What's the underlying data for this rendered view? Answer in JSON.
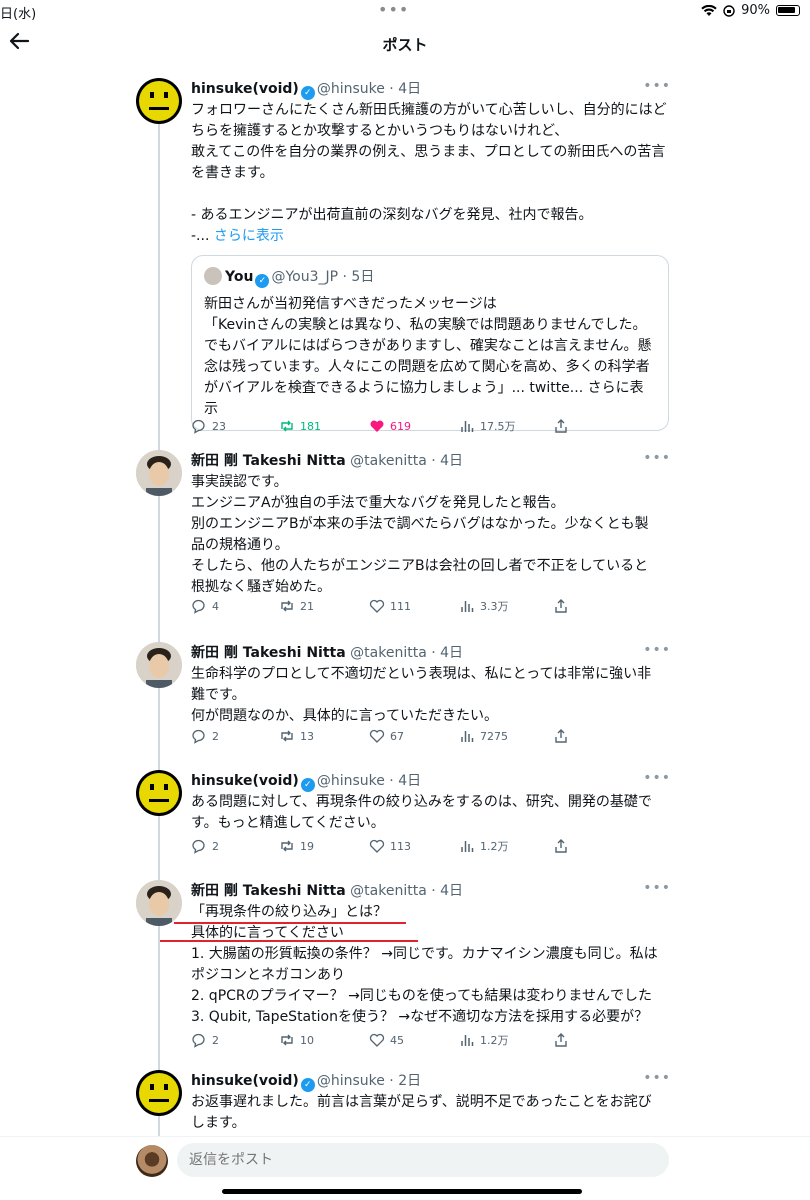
{
  "status_bar": {
    "time": "日(水)",
    "battery": "90%"
  },
  "nav": {
    "title": "ポスト"
  },
  "posts": [
    {
      "name": "hinsuke(void)",
      "handle": "@hinsuke",
      "time": "4日",
      "text": "フォロワーさんにたくさん新田氏擁護の方がいて心苦しいし、自分的にはど\nちらを擁護するとか攻撃するとかいうつもりはないけれど、\n敢えてこの件を自分の業界の例え、思うまま、プロとしての新田氏への苦言\nを書きます。\n\n- あるエンジニアが出荷直前の深刻なバグを発見、社内で報告。\n-... ",
      "show_more": "さらに表示",
      "quote": {
        "name": "You",
        "handle": "@You3_JP",
        "time": "5日",
        "text": "新田さんが当初発信すべきだったメッセージは\n「Kevinさんの実験とは異なり、私の実験では問題ありませんでした。\nでもバイアルにはばらつきがありますし、確実なことは言えません。懸\n念は残っています。人々にこの問題を広めて関心を高め、多くの科学者\nがバイアルを検査できるように協力しましょう」... twitte... さらに表示"
      },
      "stats": {
        "replies": "23",
        "reposts": "181",
        "likes": "619",
        "views": "17.5万"
      }
    },
    {
      "name": "新田 剛 Takeshi Nitta",
      "handle": "@takenitta",
      "time": "4日",
      "text": "事実誤認です。\nエンジニアAが独自の手法で重大なバグを発見したと報告。\n別のエンジニアBが本来の手法で調べたらバグはなかった。少なくとも製\n品の規格通り。\nそしたら、他の人たちがエンジニアBは会社の回し者で不正をしていると\n根拠なく騒ぎ始めた。",
      "stats": {
        "replies": "4",
        "reposts": "21",
        "likes": "111",
        "views": "3.3万"
      }
    },
    {
      "name": "新田 剛 Takeshi Nitta",
      "handle": "@takenitta",
      "time": "4日",
      "text": "生命科学のプロとして不適切だという表現は、私にとっては非常に強い非\n難です。\n何が問題なのか、具体的に言っていただきたい。",
      "stats": {
        "replies": "2",
        "reposts": "13",
        "likes": "67",
        "views": "7275"
      }
    },
    {
      "name": "hinsuke(void)",
      "handle": "@hinsuke",
      "time": "4日",
      "text": "ある問題に対して、再現条件の絞り込みをするのは、研究、開発の基礎で\nす。もっと精進してください。",
      "stats": {
        "replies": "2",
        "reposts": "19",
        "likes": "113",
        "views": "1.2万"
      }
    },
    {
      "name": "新田 剛 Takeshi Nitta",
      "handle": "@takenitta",
      "time": "4日",
      "text": "「再現条件の絞り込み」とは？\n具体的に言ってください\n1. 大腸菌の形質転換の条件？ →同じです。カナマイシン濃度も同じ。私は\nポジコンとネガコンあり\n2. qPCRのプライマー？ →同じものを使っても結果は変わりませんでした\n3. Qubit, TapeStationを使う？ →なぜ不適切な方法を採用する必要が？",
      "stats": {
        "replies": "2",
        "reposts": "10",
        "likes": "45",
        "views": "1.2万"
      }
    },
    {
      "name": "hinsuke(void)",
      "handle": "@hinsuke",
      "time": "2日",
      "text": "お返事遅れました。前言は言葉が足らず、説明不足であったことをお詫び\nします。"
    }
  ],
  "reply": {
    "placeholder": "返信をポスト"
  },
  "colors": {
    "accent": "#1d9bf0",
    "repost": "#00ba7c",
    "like": "#f91880",
    "annotation": "#e0242e"
  }
}
